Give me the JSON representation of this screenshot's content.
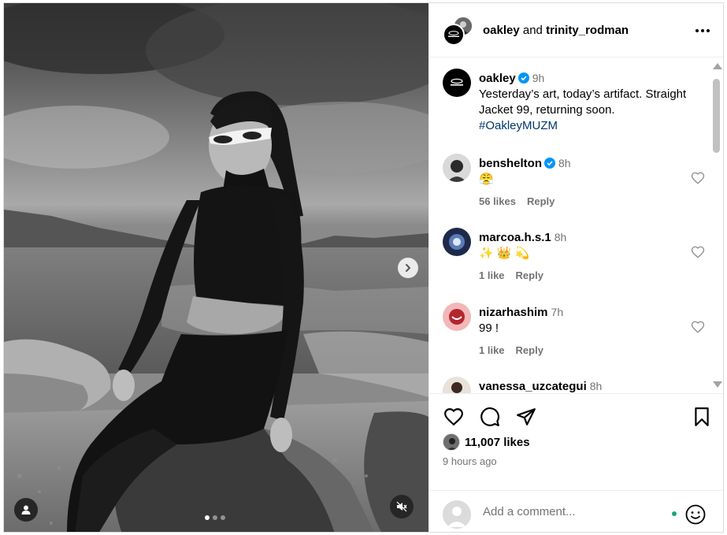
{
  "header": {
    "user1": "oakley",
    "and": "and",
    "user2": "trinity_rodman"
  },
  "caption": {
    "user": "oakley",
    "time": "9h",
    "text": "Yesterday’s art, today’s artifact. Straight Jacket 99, returning soon.",
    "hashtag": "#OakleyMUZM"
  },
  "comments": [
    {
      "user": "benshelton",
      "verified": true,
      "time": "8h",
      "text": "😤",
      "likes": "56 likes",
      "reply": "Reply"
    },
    {
      "user": "marcoa.h.s.1",
      "verified": false,
      "time": "8h",
      "text": "✨ 👑 💫",
      "likes": "1 like",
      "reply": "Reply"
    },
    {
      "user": "nizarhashim",
      "verified": false,
      "time": "7h",
      "text": "99 !",
      "likes": "1 like",
      "reply": "Reply"
    },
    {
      "user": "vanessa_uzcategui",
      "verified": false,
      "time": "8h"
    }
  ],
  "footer": {
    "likes": "11,007 likes",
    "time_ago": "9 hours ago",
    "comment_placeholder": "Add a comment..."
  },
  "media": {
    "carousel_total": 3,
    "carousel_active": 1
  },
  "colors": {
    "verified": "#0095f6",
    "link": "#00376b",
    "muted": "#737373",
    "online": "#1aa67a"
  }
}
